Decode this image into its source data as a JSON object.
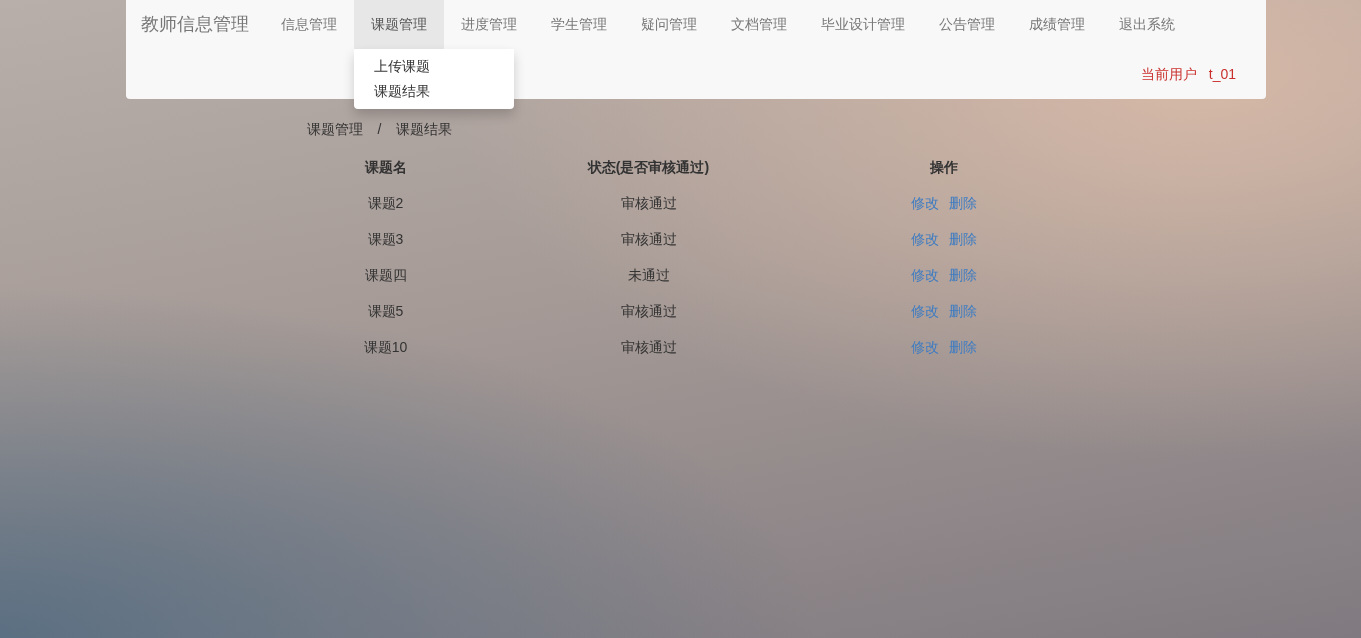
{
  "nav": {
    "brand": "教师信息管理",
    "items": [
      {
        "label": "信息管理",
        "selected": false
      },
      {
        "label": "课题管理",
        "selected": true,
        "menu": [
          "上传课题",
          "课题结果"
        ]
      },
      {
        "label": "进度管理",
        "selected": false
      },
      {
        "label": "学生管理",
        "selected": false
      },
      {
        "label": "疑问管理",
        "selected": false
      },
      {
        "label": "文档管理",
        "selected": false
      },
      {
        "label": "毕业设计管理",
        "selected": false
      },
      {
        "label": "公告管理",
        "selected": false
      },
      {
        "label": "成绩管理",
        "selected": false
      },
      {
        "label": "退出系统",
        "selected": false
      }
    ],
    "current_user": {
      "label": "当前用户",
      "value": "t_01"
    }
  },
  "breadcrumb": {
    "items": [
      "课题管理",
      "课题结果"
    ],
    "separator": "/"
  },
  "table": {
    "columns": [
      "课题名",
      "状态(是否审核通过)",
      "操作"
    ],
    "rows": [
      {
        "name": "课题2",
        "status": "审核通过",
        "actions": [
          "修改",
          "删除"
        ]
      },
      {
        "name": "课题3",
        "status": "审核通过",
        "actions": [
          "修改",
          "删除"
        ]
      },
      {
        "name": "课题四",
        "status": "未通过",
        "actions": [
          "修改",
          "删除"
        ]
      },
      {
        "name": "课题5",
        "status": "审核通过",
        "actions": [
          "修改",
          "删除"
        ]
      },
      {
        "name": "课题10",
        "status": "审核通过",
        "actions": [
          "修改",
          "删除"
        ]
      }
    ]
  }
}
